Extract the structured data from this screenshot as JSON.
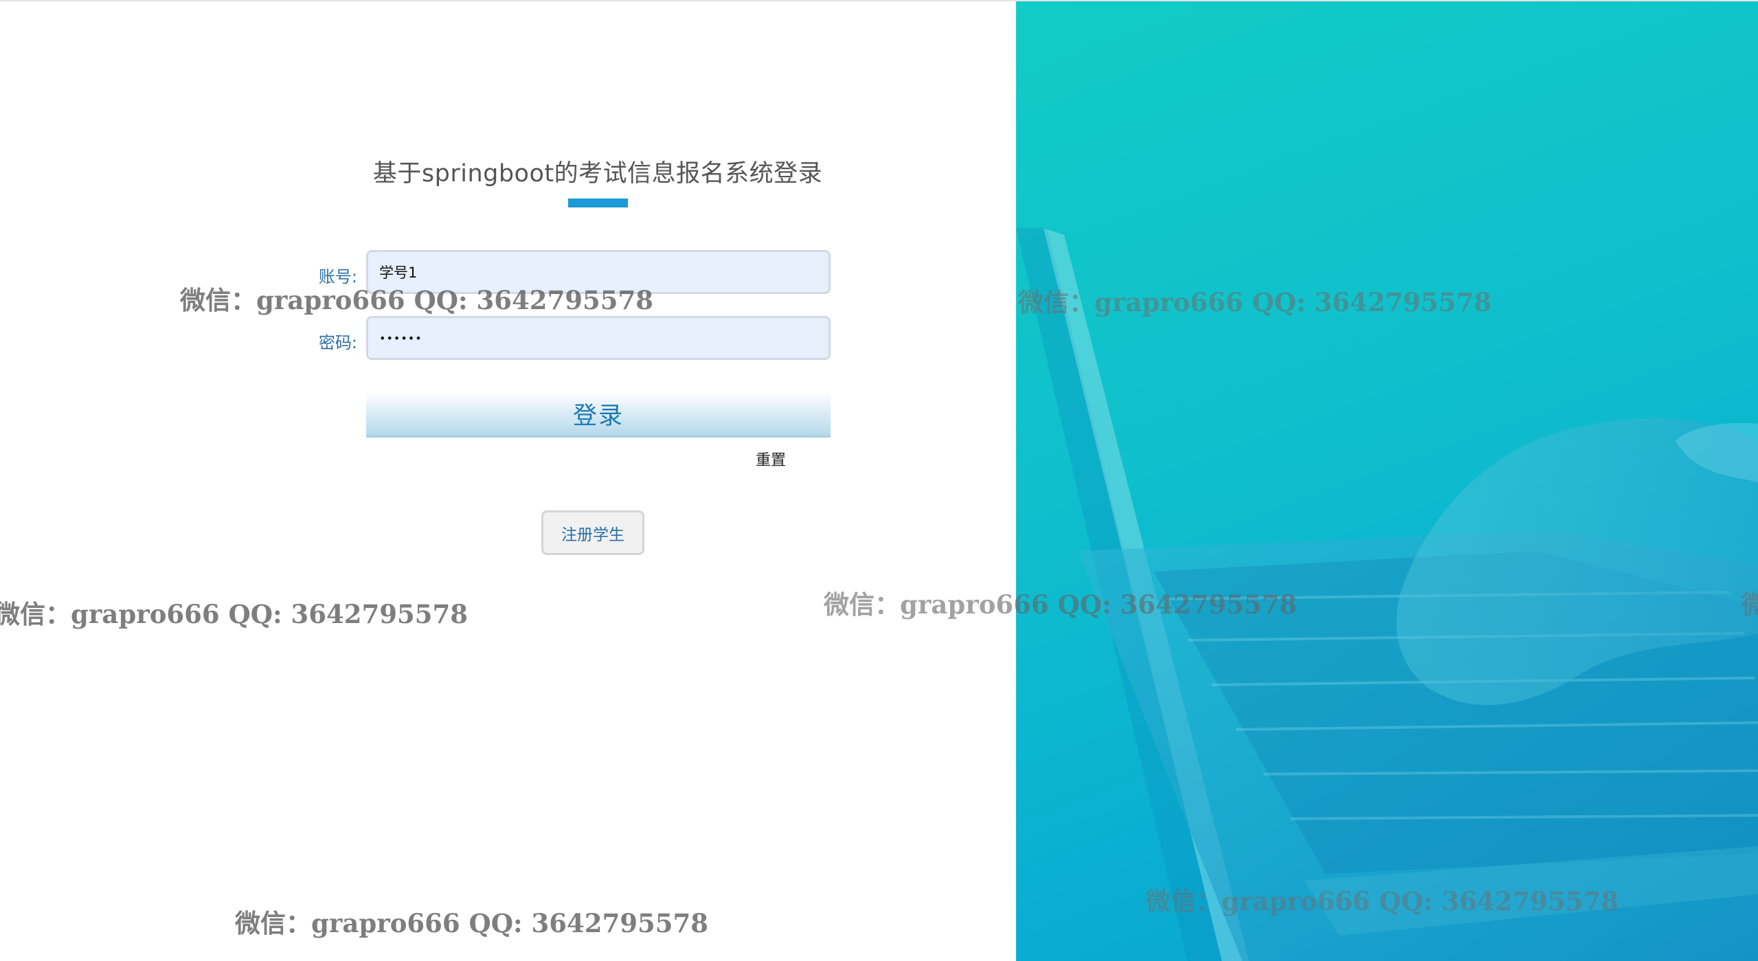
{
  "login": {
    "title": "基于springboot的考试信息报名系统登录",
    "account_label": "账号:",
    "account_value": "学号1",
    "password_label": "密码:",
    "password_value": "123456",
    "login_button": "登录",
    "reset_link": "重置",
    "register_button": "注册学生"
  },
  "colors": {
    "accent": "#1a9ad6",
    "panel": "#0fc0cc"
  },
  "watermarks": [
    "微信：grapro666 QQ: 3642795578",
    "微信：grapro666 QQ: 3642795578",
    "微信：grapro666 QQ: 3642795578",
    "微信：grapro666 QQ: 3642795578",
    "微",
    "微信：grapro666 QQ: 3642795578",
    "微信：grapro666 QQ: 3642795578"
  ]
}
